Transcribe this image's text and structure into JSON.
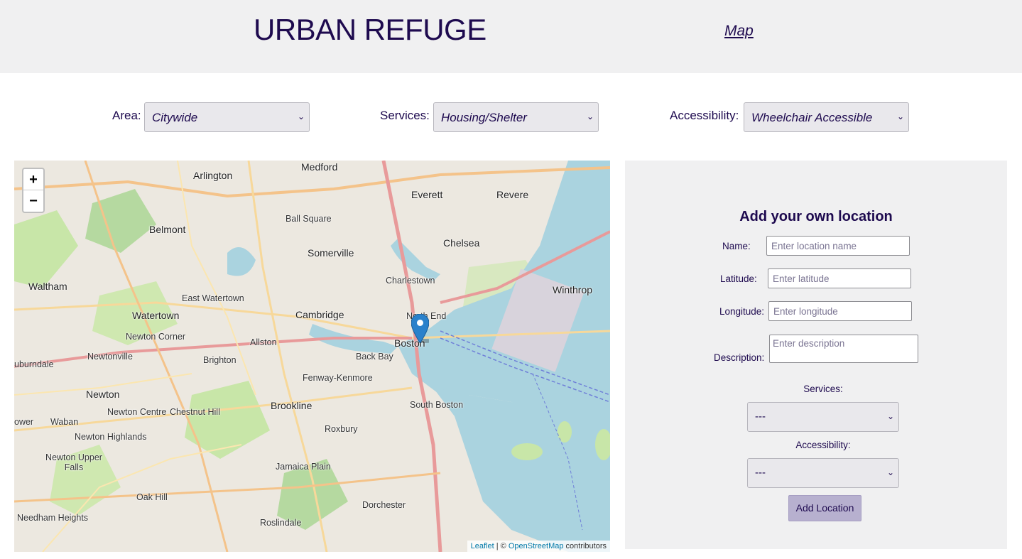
{
  "header": {
    "brand": "URBAN REFUGE",
    "nav_map": "Map"
  },
  "filters": {
    "area": {
      "label": "Area:",
      "value": "Citywide"
    },
    "services": {
      "label": "Services:",
      "value": "Housing/Shelter"
    },
    "accessibility": {
      "label": "Accessibility:",
      "value": "Wheelchair Accessible"
    }
  },
  "map": {
    "zoom_in": "+",
    "zoom_out": "−",
    "attribution": {
      "leaflet": "Leaflet",
      "sep": " | © ",
      "osm": "OpenStreetMap",
      "suffix": " contributors"
    },
    "places": [
      "Medford",
      "Arlington",
      "Everett",
      "Revere",
      "Belmont",
      "Ball Square",
      "Somerville",
      "Chelsea",
      "Waltham",
      "Charlestown",
      "Winthrop",
      "East Watertown",
      "Watertown",
      "Cambridge",
      "North End",
      "Newton Corner",
      "Allston",
      "Boston",
      "Back Bay",
      "Newtonville",
      "Brighton",
      "Fenway-Kenmore",
      "Newton",
      "South Boston",
      "Newton Centre",
      "Chestnut Hill",
      "Brookline",
      "Waban",
      "Roxbury",
      "Newton Highlands",
      "Newton Upper Falls",
      "Jamaica Plain",
      "Oak Hill",
      "Dorchester",
      "Needham Heights",
      "Roslindale",
      "uburndale",
      "ower"
    ]
  },
  "form": {
    "title": "Add your own location",
    "name": {
      "label": "Name:",
      "placeholder": "Enter location name"
    },
    "latitude": {
      "label": "Latitude:",
      "placeholder": "Enter latitude"
    },
    "longitude": {
      "label": "Longitude:",
      "placeholder": "Enter longitude"
    },
    "description": {
      "label": "Description:",
      "placeholder": "Enter description"
    },
    "services": {
      "label": "Services:",
      "value": "---"
    },
    "accessibility": {
      "label": "Accessibility:",
      "value": "---"
    },
    "submit": "Add Location"
  },
  "colors": {
    "brand": "#1e0a4f",
    "header_bg": "#f0f0f1",
    "water": "#aad3df",
    "button": "#b7b0cf"
  }
}
